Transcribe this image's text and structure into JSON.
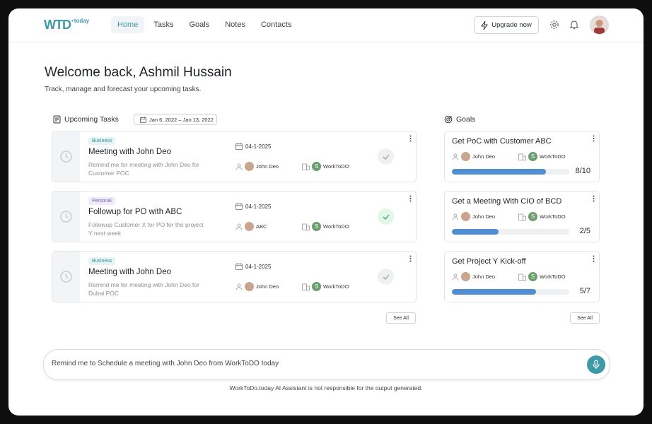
{
  "logo": {
    "text": "WTD",
    "suffix": "today"
  },
  "nav": {
    "items": [
      "Home",
      "Tasks",
      "Goals",
      "Notes",
      "Contacts"
    ],
    "active": "Home"
  },
  "header": {
    "upgrade_label": "Upgrade now"
  },
  "welcome": {
    "title": "Welcome back, Ashmil Hussain",
    "subtitle": "Track, manage and forecast your upcoming tasks."
  },
  "tasks_section": {
    "title": "Upcoming Tasks",
    "date_range": "Jan 6, 2022 – Jan 13, 2022",
    "see_all": "See All"
  },
  "tasks": [
    {
      "tag": "Business",
      "title": "Meeting with  John Deo",
      "desc": "Remind me for meeting with John Deo for Customer POC",
      "date": "04-1-2025",
      "user": "John Deo",
      "org": "WorkToDO",
      "done": false
    },
    {
      "tag": "Personal",
      "title": "Followup for PO with  ABC",
      "desc": "Followup Customer X for PO for the project Y next week",
      "date": "04-1-2025",
      "user": "ABC",
      "org": "WorkToDO",
      "done": true
    },
    {
      "tag": "Business",
      "title": "Meeting with  John Deo",
      "desc": "Remind me for meeting with John Deo for Dubai POC",
      "date": "04-1-2025",
      "user": "John Deo",
      "org": "WorkToDO",
      "done": false
    }
  ],
  "goals_section": {
    "title": "Goals",
    "see_all": "See All"
  },
  "goals": [
    {
      "title": "Get PoC with Customer ABC",
      "user": "John Deo",
      "org": "WorkToDO",
      "progress": "8/10",
      "fraction": 0.8
    },
    {
      "title": "Get a Meeting With CIO of BCD",
      "user": "John Deo",
      "org": "WorkToDO",
      "progress": "2/5",
      "fraction": 0.4
    },
    {
      "title": "Get Project Y Kick-off",
      "user": "John Deo",
      "org": "WorkToDO",
      "progress": "5/7",
      "fraction": 0.714
    }
  ],
  "assistant": {
    "input_value": "Remind me to Schedule a meeting with John Deo from WorkToDO today",
    "disclaimer": "WorkToDo.today AI Assistant is not responsible for the output generated."
  },
  "colors": {
    "accent": "#3f9aa8",
    "progress": "#4f8fd1",
    "done": "#3aa865"
  }
}
